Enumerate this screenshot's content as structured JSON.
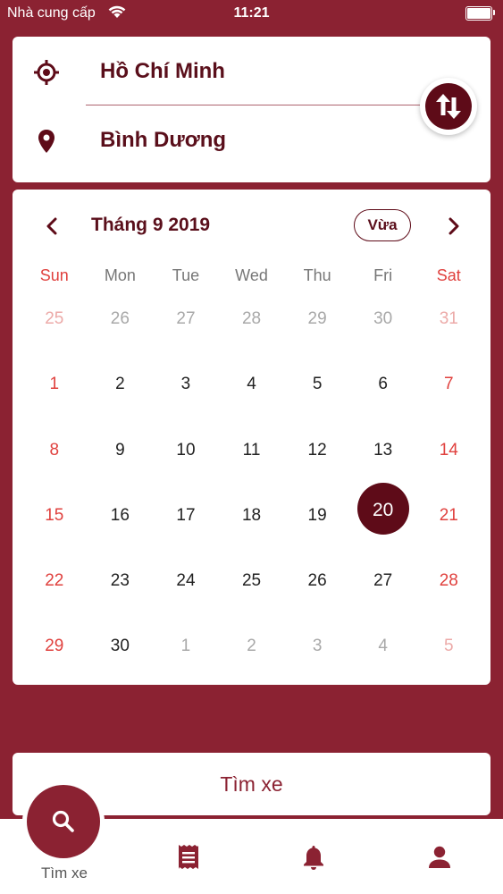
{
  "status": {
    "carrier": "Nhà cung cấp",
    "time": "11:21"
  },
  "route": {
    "from": "Hồ Chí Minh",
    "to": "Bình Dương"
  },
  "calendar": {
    "title": "Tháng 9 2019",
    "today_label": "Vừa",
    "weekdays": [
      "Sun",
      "Mon",
      "Tue",
      "Wed",
      "Thu",
      "Fri",
      "Sat"
    ],
    "weeks": [
      [
        "25",
        "26",
        "27",
        "28",
        "29",
        "30",
        "31"
      ],
      [
        "1",
        "2",
        "3",
        "4",
        "5",
        "6",
        "7"
      ],
      [
        "8",
        "9",
        "10",
        "11",
        "12",
        "13",
        "14"
      ],
      [
        "15",
        "16",
        "17",
        "18",
        "19",
        "20",
        "21"
      ],
      [
        "22",
        "23",
        "24",
        "25",
        "26",
        "27",
        "28"
      ],
      [
        "29",
        "30",
        "1",
        "2",
        "3",
        "4",
        "5"
      ]
    ],
    "selected": "20"
  },
  "search_button": "Tìm xe",
  "tabbar": {
    "search_label": "Tìm xe"
  },
  "colors": {
    "primary": "#8b2232",
    "dark": "#5e0b18",
    "weekend": "#e0413e"
  },
  "icons": [
    "wifi-icon",
    "battery-icon",
    "target-location-icon",
    "map-pin-icon",
    "swap-icon",
    "chevron-left-icon",
    "chevron-right-icon",
    "search-icon",
    "ticket-icon",
    "bell-icon",
    "user-icon"
  ]
}
